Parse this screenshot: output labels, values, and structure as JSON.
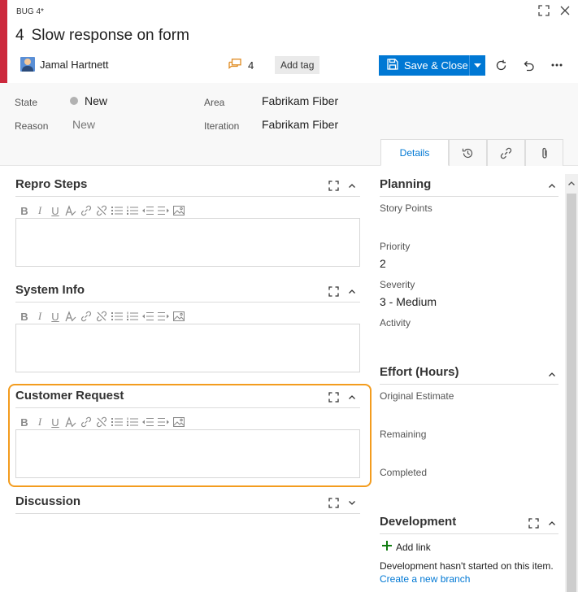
{
  "header": {
    "bug_label": "BUG 4*",
    "id": "4",
    "title": "Slow response on form",
    "assignee": "Jamal Hartnett",
    "comment_count": "4",
    "add_tag": "Add tag",
    "save_label": "Save & Close"
  },
  "fields": {
    "state_label": "State",
    "state_value": "New",
    "reason_label": "Reason",
    "reason_value": "New",
    "area_label": "Area",
    "area_value": "Fabrikam Fiber",
    "iteration_label": "Iteration",
    "iteration_value": "Fabrikam Fiber"
  },
  "tabs": {
    "details": "Details"
  },
  "sections": {
    "repro_steps": "Repro Steps",
    "system_info": "System Info",
    "customer_request": "Customer Request",
    "discussion": "Discussion"
  },
  "planning": {
    "title": "Planning",
    "story_points_label": "Story Points",
    "priority_label": "Priority",
    "priority_value": "2",
    "severity_label": "Severity",
    "severity_value": "3 - Medium",
    "activity_label": "Activity"
  },
  "effort": {
    "title": "Effort (Hours)",
    "original_label": "Original Estimate",
    "remaining_label": "Remaining",
    "completed_label": "Completed"
  },
  "development": {
    "title": "Development",
    "add_link": "Add link",
    "message": "Development hasn't started on this item.",
    "create_branch": "Create a new branch"
  },
  "colors": {
    "accent": "#0078d4",
    "bug_red": "#cc293d",
    "highlight": "#f39c1e",
    "comment_icon": "#e08a1e",
    "add_link_icon": "#107c10"
  }
}
